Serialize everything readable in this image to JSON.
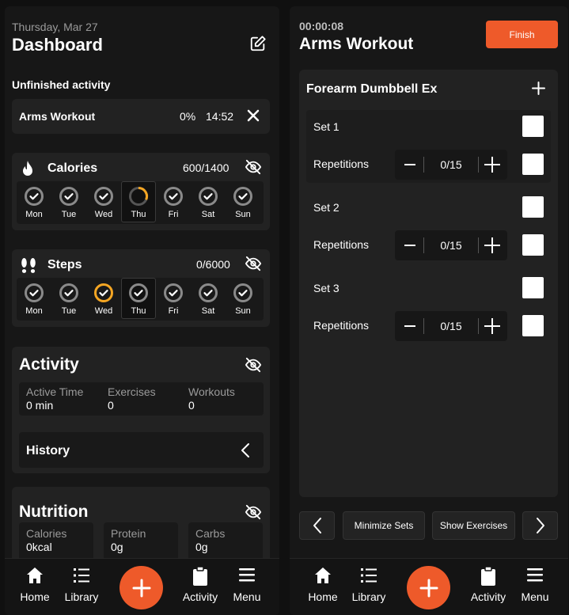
{
  "dashboard": {
    "date": "Thursday, Mar 27",
    "title": "Dashboard",
    "unfinished_heading": "Unfinished activity",
    "unfinished": {
      "name": "Arms Workout",
      "percent": "0%",
      "time": "14:52"
    },
    "calories": {
      "label": "Calories",
      "value": "600/1400"
    },
    "steps": {
      "label": "Steps",
      "value": "0/6000"
    },
    "days": [
      "Mon",
      "Tue",
      "Wed",
      "Thu",
      "Fri",
      "Sat",
      "Sun"
    ],
    "activity": {
      "title": "Activity",
      "active_time_label": "Active Time",
      "active_time_value": "0 min",
      "exercises_label": "Exercises",
      "exercises_value": "0",
      "workouts_label": "Workouts",
      "workouts_value": "0",
      "history_label": "History"
    },
    "nutrition": {
      "title": "Nutrition",
      "calories_label": "Calories",
      "calories_value": "0kcal",
      "protein_label": "Protein",
      "protein_value": "0g",
      "carbs_label": "Carbs",
      "carbs_value": "0g"
    }
  },
  "workout": {
    "timer": "00:00:08",
    "title": "Arms Workout",
    "finish_label": "Finish",
    "exercise_name": "Forearm Dumbbell Ex",
    "sets": [
      {
        "label": "Set 1",
        "reps_label": "Repetitions",
        "reps_value": "0/15"
      },
      {
        "label": "Set 2",
        "reps_label": "Repetitions",
        "reps_value": "0/15"
      },
      {
        "label": "Set 3",
        "reps_label": "Repetitions",
        "reps_value": "0/15"
      }
    ],
    "minimize_label": "Minimize Sets",
    "show_exercises_label": "Show Exercises"
  },
  "nav": {
    "home": "Home",
    "library": "Library",
    "activity": "Activity",
    "menu": "Menu"
  },
  "colors": {
    "accent": "#ee5a2a",
    "ring_orange": "#f5a623",
    "ring_gray": "#8a8a8a"
  }
}
